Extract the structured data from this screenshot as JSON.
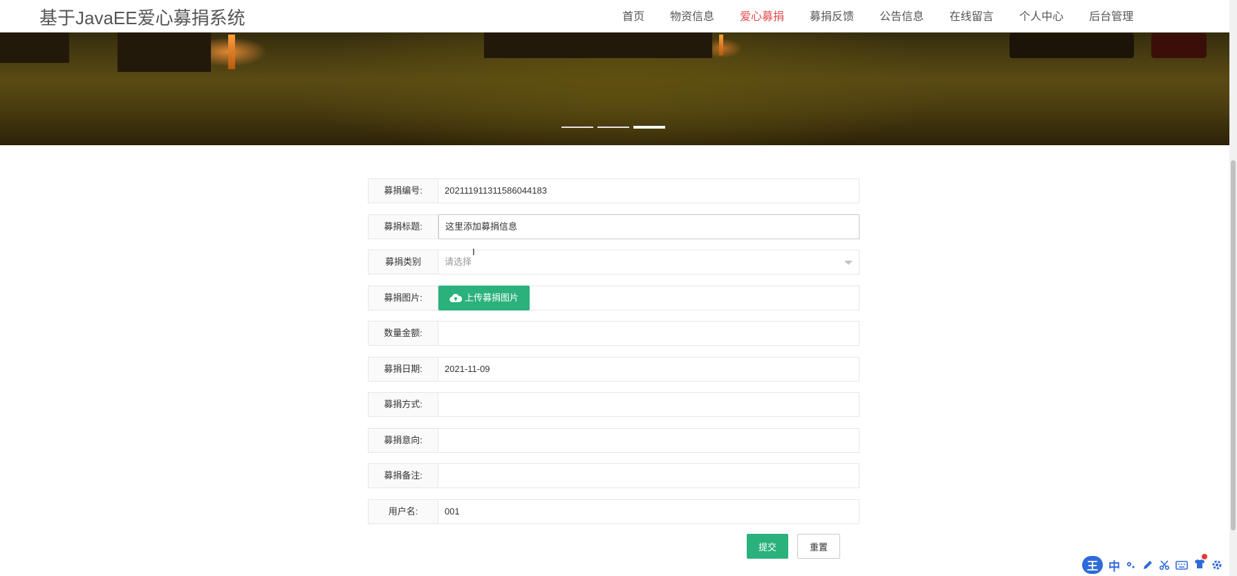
{
  "header": {
    "brand": "基于JavaEE爱心募捐系统",
    "nav": [
      "首页",
      "物资信息",
      "爱心募捐",
      "募捐反馈",
      "公告信息",
      "在线留言",
      "个人中心",
      "后台管理"
    ],
    "active_nav": "爱心募捐"
  },
  "banner": {
    "carousel_total": 3,
    "carousel_active": 3
  },
  "form": {
    "donation_no_label": "募捐编号:",
    "donation_no_value": "202111911311586044183",
    "title_label": "募捐标题:",
    "title_value": "这里添加募捐信息",
    "category_label": "募捐类别",
    "category_placeholder": "请选择",
    "image_label": "募捐图片:",
    "upload_button": "上传募捐图片",
    "amount_label": "数量金额:",
    "amount_value": "",
    "date_label": "募捐日期:",
    "date_value": "2021-11-09",
    "method_label": "募捐方式:",
    "method_value": "",
    "intent_label": "募捐意向:",
    "intent_value": "",
    "remark_label": "募捐备注:",
    "remark_value": "",
    "username_label": "用户名:",
    "username_value": "001"
  },
  "actions": {
    "submit": "提交",
    "reset": "重置"
  },
  "ime": {
    "logo": "王",
    "mode": "中",
    "icons": [
      "punctuation-icon",
      "pen-icon",
      "scissors-icon",
      "keyboard-icon",
      "skin-icon",
      "settings-icon"
    ]
  },
  "colors": {
    "primary_green": "#2bb17c",
    "nav_active": "#e24a4a",
    "ime_blue": "#2f6bd8"
  }
}
